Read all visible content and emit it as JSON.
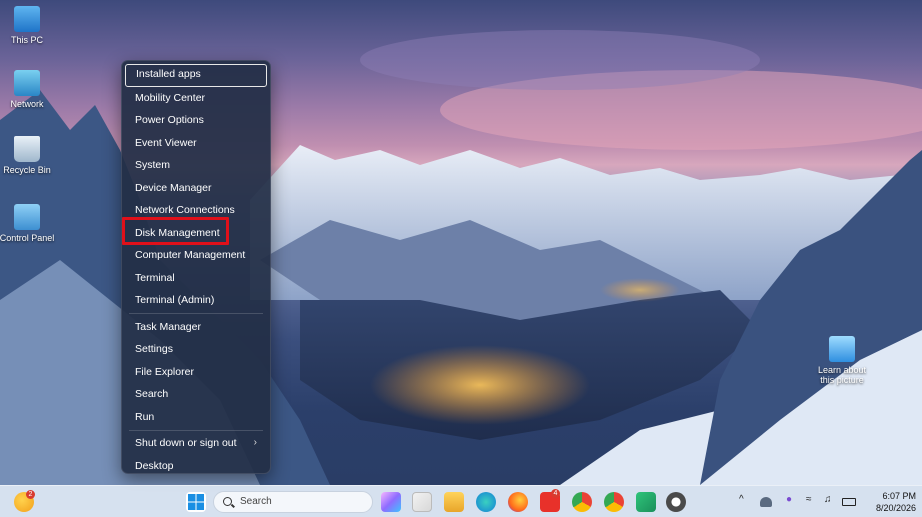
{
  "desktop": {
    "icons": [
      {
        "label": "This PC",
        "icon": "this-pc-icon"
      },
      {
        "label": "Network",
        "icon": "network-icon"
      },
      {
        "label": "Recycle Bin",
        "icon": "recycle-bin-icon"
      },
      {
        "label": "Control Panel",
        "icon": "control-panel-icon"
      },
      {
        "label": "Learn about this picture",
        "icon": "learn-picture-icon"
      }
    ]
  },
  "menu": {
    "items": [
      {
        "label": "Installed apps"
      },
      {
        "label": "Mobility Center"
      },
      {
        "label": "Power Options"
      },
      {
        "label": "Event Viewer"
      },
      {
        "label": "System"
      },
      {
        "label": "Device Manager"
      },
      {
        "label": "Network Connections"
      },
      {
        "label": "Disk Management"
      },
      {
        "label": "Computer Management"
      },
      {
        "label": "Terminal"
      },
      {
        "label": "Terminal (Admin)"
      },
      {
        "label": "Task Manager"
      },
      {
        "label": "Settings"
      },
      {
        "label": "File Explorer"
      },
      {
        "label": "Search"
      },
      {
        "label": "Run"
      },
      {
        "label": "Shut down or sign out",
        "arrow": "›"
      },
      {
        "label": "Desktop"
      }
    ]
  },
  "taskbar": {
    "search_placeholder": "Search",
    "weather_badge": "2",
    "app_badge": "4",
    "time": "6:07 PM",
    "date": "8/20/2026"
  },
  "colors": {
    "highlight": "#e0101a",
    "menu_bg": "#222e46",
    "taskbar_bg": "#d2deee"
  }
}
